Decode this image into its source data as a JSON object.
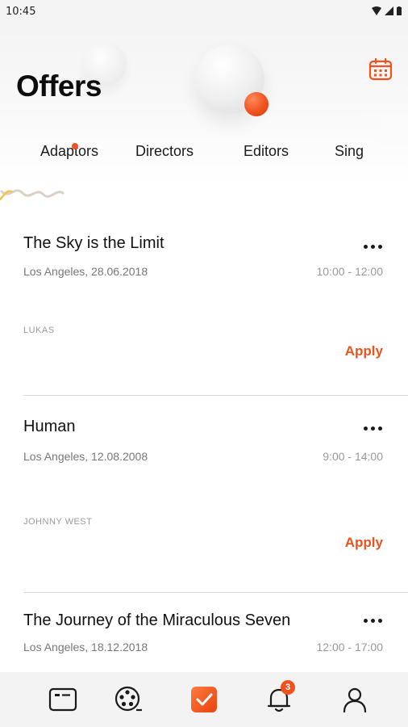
{
  "status_bar": {
    "time": "10:45"
  },
  "header": {
    "title": "Offers"
  },
  "tabs": [
    {
      "label": "Adaptors",
      "active": true
    },
    {
      "label": "Directors",
      "active": false
    },
    {
      "label": "Editors",
      "active": false
    },
    {
      "label": "Sing",
      "active": false
    }
  ],
  "offers": [
    {
      "title": "The Sky is the Limit",
      "location_date": "Los Angeles, 28.06.2018",
      "time": "10:00 - 12:00",
      "person": "LUKAS",
      "action": "Apply"
    },
    {
      "title": "Human",
      "location_date": "Los Angeles, 12.08.2008",
      "time": "9:00 - 14:00",
      "person": "JOHNNY WEST",
      "action": "Apply"
    },
    {
      "title": "The Journey of the Miraculous Seven",
      "location_date": "Los Angeles, 18.12.2018",
      "time": "12:00 - 17:00"
    }
  ],
  "bottom_nav": {
    "items": [
      "id-card-icon",
      "film-reel-icon",
      "checkbox-icon",
      "bell-icon",
      "user-icon"
    ],
    "notification_count": "3"
  },
  "colors": {
    "accent": "#f0521e",
    "text": "#111111",
    "muted": "#777777",
    "divider": "#d8d8d8"
  }
}
